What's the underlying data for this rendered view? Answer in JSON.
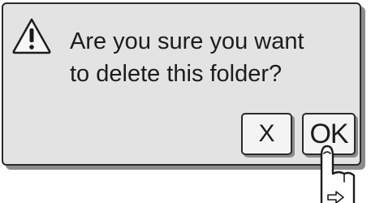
{
  "dialog": {
    "icon": "warning-triangle-icon",
    "message_line1": "Are you sure you want",
    "message_line2": "to delete this folder?",
    "cancel_label": "X",
    "ok_label": "OK"
  },
  "pointer": {
    "icon": "hand-pointer-icon"
  },
  "colors": {
    "dialog_bg": "#e3e3e3",
    "button_bg": "#f4f4f4",
    "border": "#2a2a2a",
    "shadow": "#8c8c8c"
  }
}
